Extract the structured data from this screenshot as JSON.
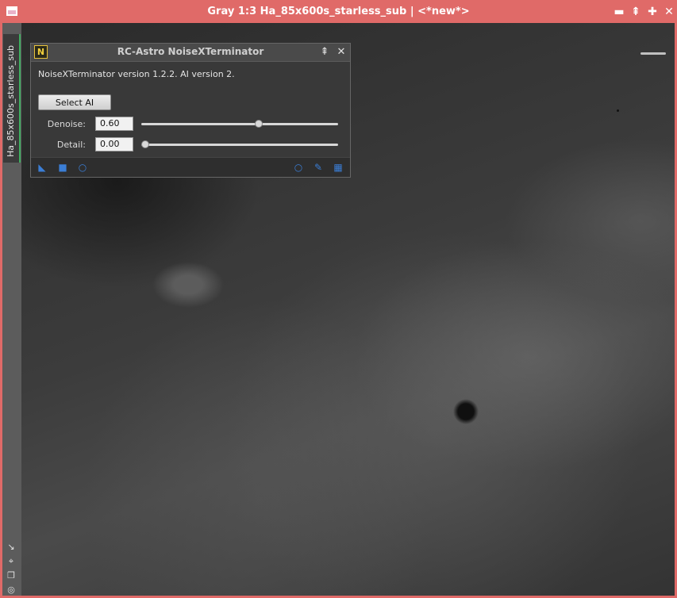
{
  "window": {
    "title": "Gray 1:3 Ha_85x600s_starless_sub | <*new*>",
    "tab_label": "Ha_85x600s_starless_sub",
    "controls": {
      "minimize": "▬",
      "shade": "⇞",
      "maximize": "✚",
      "close": "✕"
    },
    "left_icons": [
      "↘",
      "⌖",
      "❐",
      "◎"
    ]
  },
  "dialog": {
    "icon_letter": "N",
    "title": "RC-Astro NoiseXTerminator",
    "version_text": "NoiseXTerminator version 1.2.2. AI version 2.",
    "select_ai_label": "Select AI",
    "denoise": {
      "label": "Denoise:",
      "value": "0.60",
      "fraction": 0.6
    },
    "detail": {
      "label": "Detail:",
      "value": "0.00",
      "fraction": 0.0
    },
    "title_controls": {
      "shade": "⇞",
      "close": "✕"
    },
    "footer_left_icons": [
      "◣",
      "■",
      "○"
    ],
    "footer_right_icons": [
      "○",
      "✎",
      "▦"
    ]
  },
  "colors": {
    "window_border": "#e06a68",
    "tab_active": "#3fae60",
    "accent_icons": "#3b7ed6",
    "dialog_icon": "#f2cf3c"
  }
}
